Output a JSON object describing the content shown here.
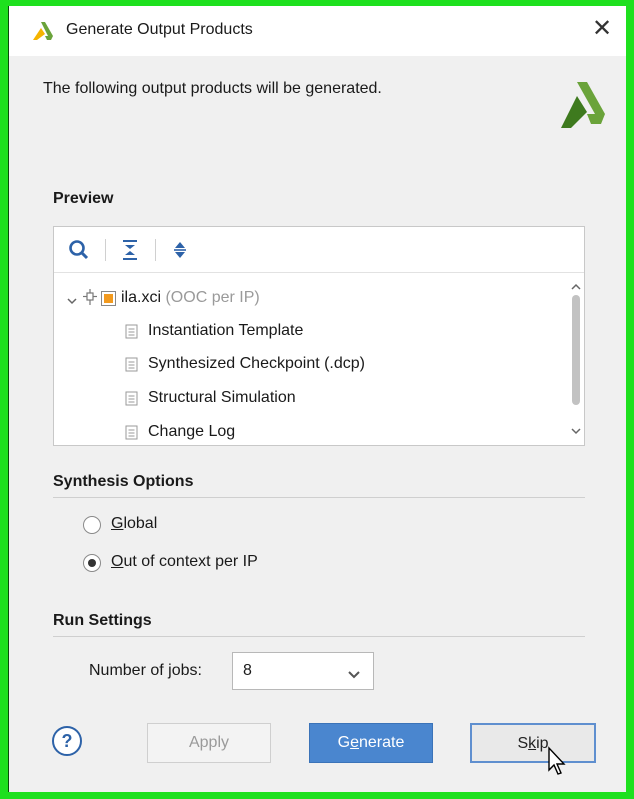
{
  "window": {
    "title": "Generate Output Products",
    "close_glyph": "✕",
    "description": "The following output products will be generated."
  },
  "preview": {
    "title": "Preview",
    "toolbar_icons": [
      "search-icon",
      "collapse-all-icon",
      "expand-all-icon"
    ],
    "tree": {
      "root": {
        "name": "ila.xci",
        "suffix": "(OOC per IP)"
      },
      "children": [
        "Instantiation Template",
        "Synthesized Checkpoint (.dcp)",
        "Structural Simulation",
        "Change Log"
      ]
    }
  },
  "synthesis": {
    "title": "Synthesis Options",
    "global_label": "Global",
    "ooc_label": "Out of context per IP",
    "selected": "ooc"
  },
  "run": {
    "title": "Run Settings",
    "jobs_label_pre": "Number of ",
    "jobs_label_u": "j",
    "jobs_label_post": "obs:",
    "jobs_value": "8"
  },
  "buttons": {
    "help": "?",
    "apply": "Apply",
    "generate_pre": "G",
    "generate_u": "e",
    "generate_post": "nerate",
    "skip_pre": "S",
    "skip_u": "k",
    "skip_post": "ip"
  },
  "colors": {
    "accent": "#4a86cf",
    "logo_green": "#6aa33a",
    "logo_yellow": "#f5b400",
    "frame_green": "#1ee01e"
  }
}
